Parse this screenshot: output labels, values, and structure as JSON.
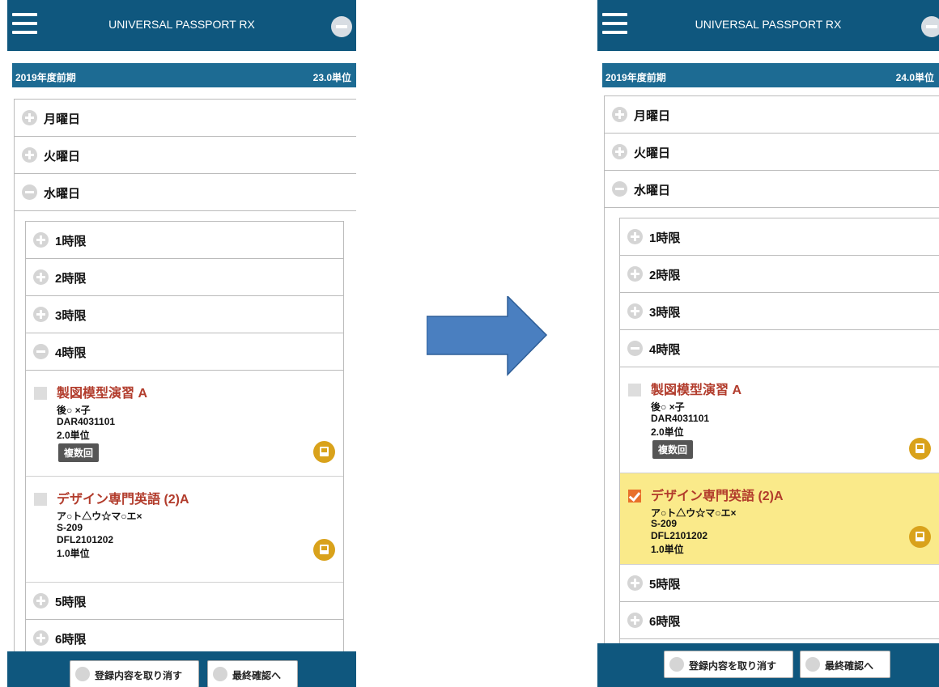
{
  "app": {
    "title": "UNIVERSAL PASSPORT RX"
  },
  "before": {
    "term": {
      "label": "2019年度前期",
      "units": "23.0単位"
    },
    "days": [
      {
        "label": "月曜日",
        "state": "collapsed"
      },
      {
        "label": "火曜日",
        "state": "collapsed"
      },
      {
        "label": "水曜日",
        "state": "expanded"
      }
    ],
    "periods": [
      {
        "label": "1時限"
      },
      {
        "label": "2時限"
      },
      {
        "label": "3時限"
      },
      {
        "label": "4時限"
      },
      {
        "label": "5時限"
      },
      {
        "label": "6時限"
      }
    ],
    "courses": [
      {
        "title": "製図模型演習 A",
        "teacher": "後○ ×子",
        "code": "DAR4031101",
        "credits": "2.0単位",
        "badge": "複数回",
        "checked": false
      },
      {
        "title": "デザイン専門英語 (2)A",
        "teacher": "ア○ト△ウ☆マ○エ×",
        "room": "S-209",
        "code": "DFL2101202",
        "credits": "1.0単位",
        "checked": false
      }
    ]
  },
  "after": {
    "term": {
      "label": "2019年度前期",
      "units": "24.0単位"
    },
    "days": [
      {
        "label": "月曜日"
      },
      {
        "label": "火曜日"
      },
      {
        "label": "水曜日"
      }
    ],
    "periods": [
      {
        "label": "1時限"
      },
      {
        "label": "2時限"
      },
      {
        "label": "3時限"
      },
      {
        "label": "4時限"
      },
      {
        "label": "5時限"
      },
      {
        "label": "6時限"
      }
    ],
    "courses": [
      {
        "title": "製図模型演習 A",
        "teacher": "後○ ×子",
        "code": "DAR4031101",
        "credits": "2.0単位",
        "badge": "複数回",
        "checked": false
      },
      {
        "title": "デザイン専門英語 (2)A",
        "teacher": "ア○ト△ウ☆マ○エ×",
        "room": "S-209",
        "code": "DFL2101202",
        "credits": "1.0単位",
        "checked": true
      }
    ]
  },
  "buttons": {
    "cancel": "登録内容を取り消す",
    "confirm": "最終確認へ"
  },
  "colors": {
    "header": "#0f577e",
    "term_bar": "#1d6b93",
    "course_title": "#b23c2c",
    "selected_bg": "#faea8a",
    "checkbox_on": "#e8702a",
    "book_icon": "#d9a21b",
    "arrow": "#4a7fc0"
  }
}
